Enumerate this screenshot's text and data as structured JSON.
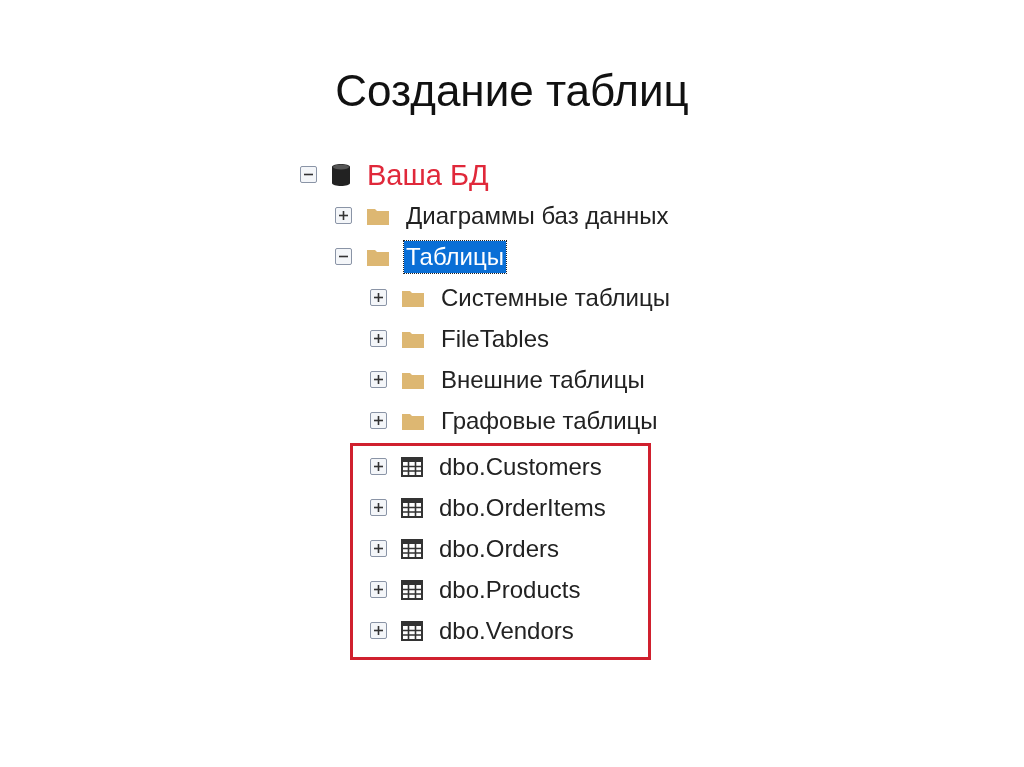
{
  "slide": {
    "title": "Создание таблиц"
  },
  "tree": [
    {
      "label": "Ваша БД",
      "kind": "database",
      "expanded": true,
      "selected": false,
      "children": [
        {
          "label": "Диаграммы баз данных",
          "kind": "folder",
          "expanded": false,
          "selected": false
        },
        {
          "label": "Таблицы",
          "kind": "folder",
          "expanded": true,
          "selected": true,
          "children": [
            {
              "label": "Системные таблицы",
              "kind": "folder",
              "expanded": false,
              "selected": false
            },
            {
              "label": "FileTables",
              "kind": "folder",
              "expanded": false,
              "selected": false
            },
            {
              "label": "Внешние таблицы",
              "kind": "folder",
              "expanded": false,
              "selected": false
            },
            {
              "label": "Графовые таблицы",
              "kind": "folder",
              "expanded": false,
              "selected": false
            },
            {
              "label": "dbo.Customers",
              "kind": "table",
              "expanded": false,
              "selected": false,
              "highlighted": true
            },
            {
              "label": "dbo.OrderItems",
              "kind": "table",
              "expanded": false,
              "selected": false,
              "highlighted": true
            },
            {
              "label": "dbo.Orders",
              "kind": "table",
              "expanded": false,
              "selected": false,
              "highlighted": true
            },
            {
              "label": "dbo.Products",
              "kind": "table",
              "expanded": false,
              "selected": false,
              "highlighted": true
            },
            {
              "label": "dbo.Vendors",
              "kind": "table",
              "expanded": false,
              "selected": false,
              "highlighted": true
            }
          ]
        }
      ]
    }
  ]
}
